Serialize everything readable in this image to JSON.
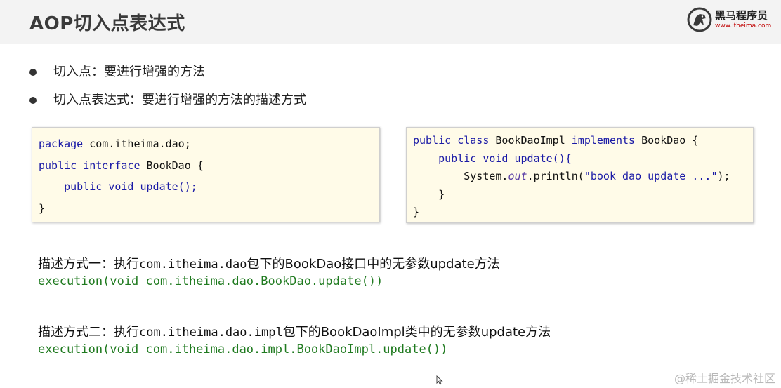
{
  "header": {
    "title": "AOP切入点表达式",
    "logo_name": "黑马程序员",
    "logo_url": "www.itheima.com"
  },
  "bullets": [
    "切入点：要进行增强的方法",
    "切入点表达式：要进行增强的方法的描述方式"
  ],
  "code_interface": {
    "line1_kw": "package",
    "line1_rest": " com.itheima.dao;",
    "line2_kw1": "public",
    "line2_kw2": "interface",
    "line2_rest": " BookDao {",
    "line3_kw1": "public",
    "line3_kw2": "void",
    "line3_rest": " update();",
    "line4": "}"
  },
  "code_impl": {
    "line1_kw1": "public",
    "line1_kw2": "class",
    "line1_mid": " BookDaoImpl ",
    "line1_kw3": "implements",
    "line1_rest": " BookDao {",
    "line2_kw1": "public",
    "line2_kw2": "void",
    "line2_rest": " update(){",
    "line3_pre": "System.",
    "line3_field": "out",
    "line3_mid": ".println(",
    "line3_str": "\"book dao update ...\"",
    "line3_end": ");",
    "line4": "}",
    "line5": "}"
  },
  "descriptions": [
    {
      "label_prefix": "描述方式一：执行",
      "label_pkg": "com.itheima.dao",
      "label_mid": "包下的",
      "label_cls": "BookDao",
      "label_mid2": "接口中的无参数",
      "label_method": "update",
      "label_suffix": "方法",
      "expression": "execution(void com.itheima.dao.BookDao.update())"
    },
    {
      "label_prefix": "描述方式二：执行",
      "label_pkg": "com.itheima.dao.impl",
      "label_mid": "包下的",
      "label_cls": "BookDaoImpl",
      "label_mid2": "类中的无参数",
      "label_method": "update",
      "label_suffix": "方法",
      "expression": "execution(void com.itheima.dao.impl.BookDaoImpl.update())"
    }
  ],
  "watermark": "@稀土掘金技术社区",
  "colors": {
    "header_bg": "#f3f3f3",
    "code_bg": "#fffbe8",
    "keyword": "#1a1aa6",
    "expression": "#1f7a1f",
    "logo_url": "#c00000"
  },
  "icons": [
    "horse-logo-icon",
    "cursor-icon",
    "bullet-dot-icon"
  ]
}
